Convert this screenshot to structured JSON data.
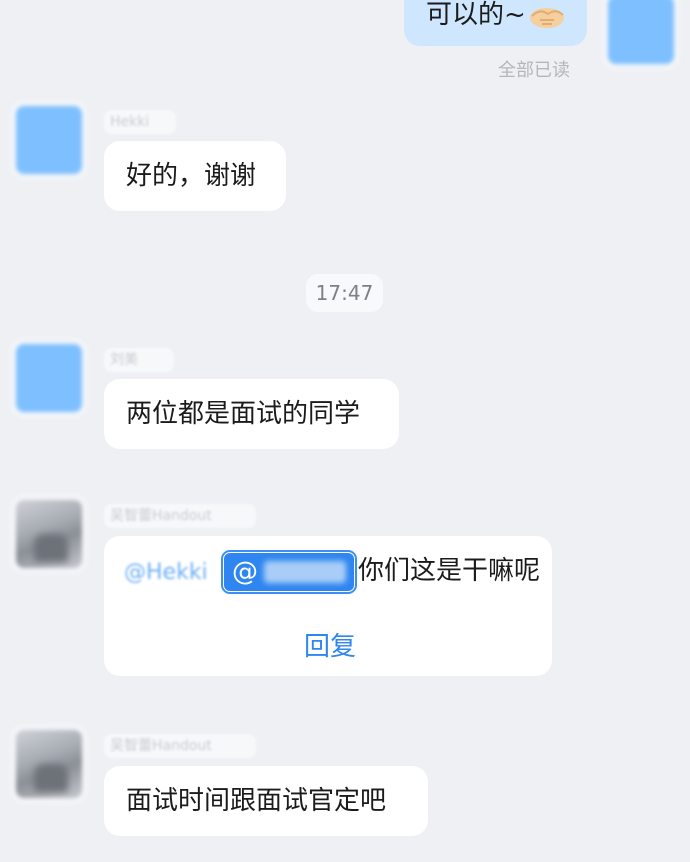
{
  "messages": {
    "mine_top": {
      "text": "可以的~",
      "read_status": "全部已读",
      "emoji": "handshake-emoji"
    },
    "msg1": {
      "sender": "Hekki",
      "text": "好的，谢谢"
    },
    "time": "17:47",
    "msg2": {
      "sender": "刘美",
      "text": "两位都是面试的同学"
    },
    "msg3": {
      "sender": "吴智蕾Handout",
      "mention1": "@Hekki",
      "mention2_at": "@",
      "text": "你们这是干嘛呢",
      "reply": "回复"
    },
    "msg4": {
      "sender": "吴智蕾Handout",
      "text": "面试时间跟面试官定吧"
    }
  },
  "colors": {
    "background": "#eef0f4",
    "my_bubble": "#cfe6ff",
    "other_bubble": "#ffffff",
    "link_blue": "#2f86f0"
  }
}
